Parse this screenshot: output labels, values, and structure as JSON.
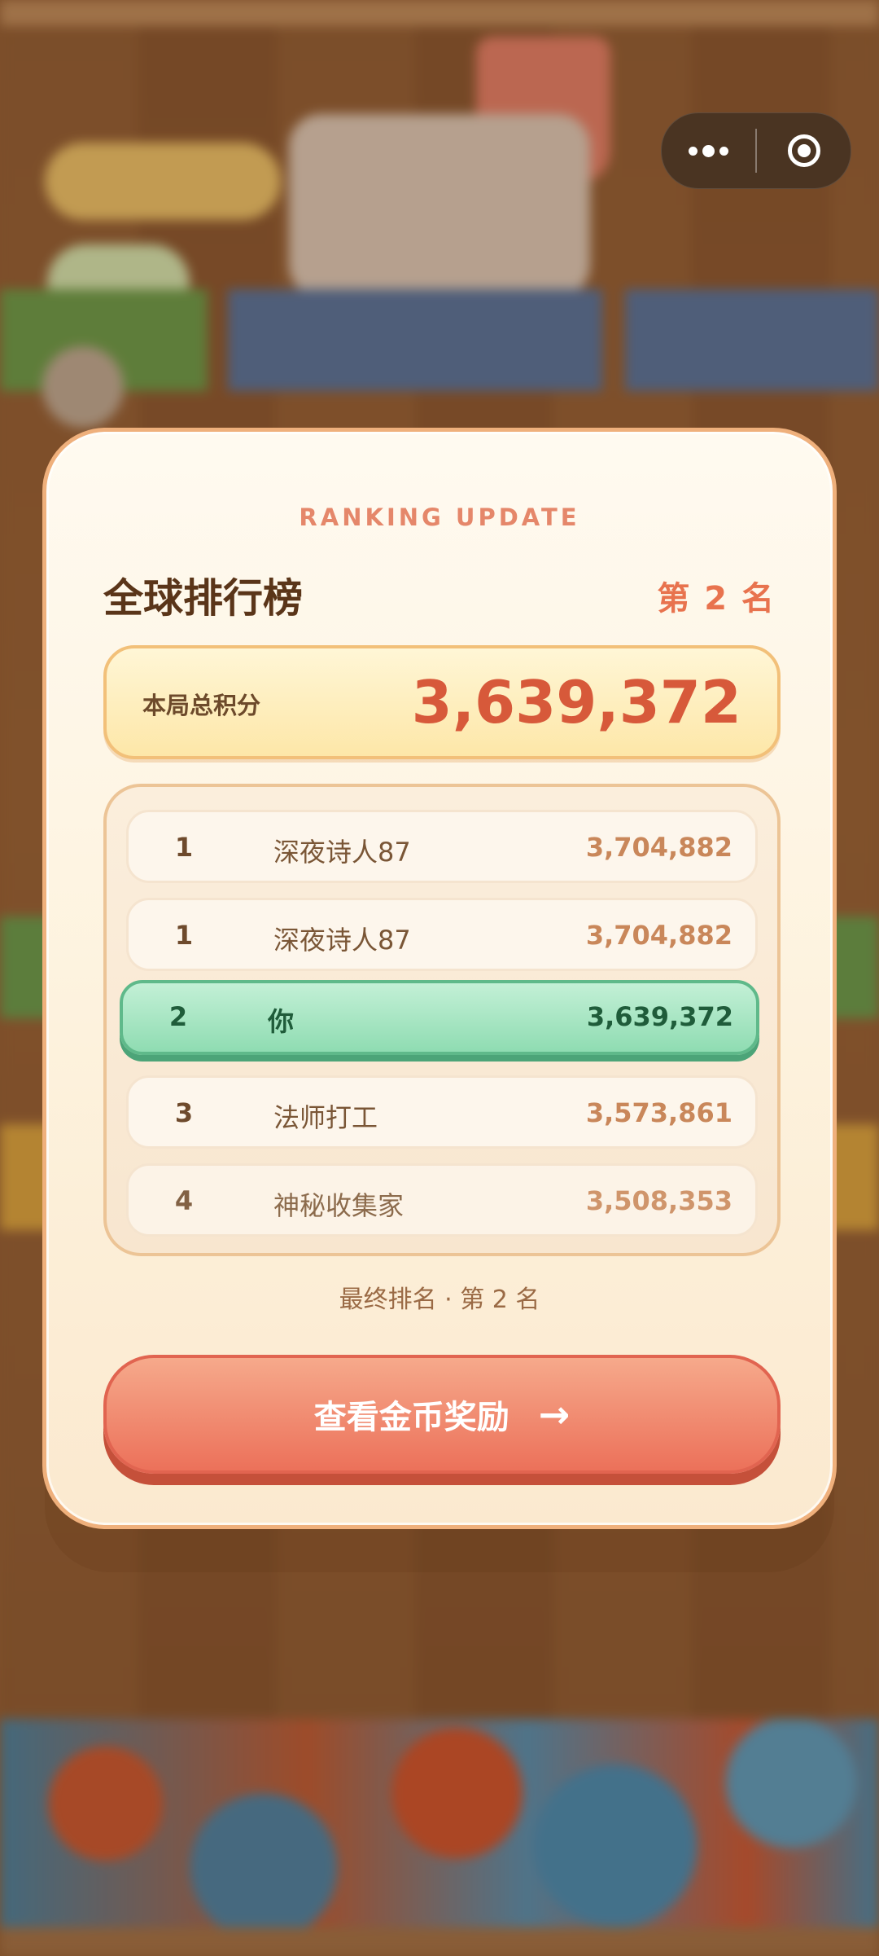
{
  "modal": {
    "eyebrow": "RANKING UPDATE",
    "title": "全球排行榜",
    "rank_badge": "第 2 名",
    "score_label": "本局总积分",
    "score_value": "3,639,372",
    "rows": [
      {
        "rank": "1",
        "name": "深夜诗人87",
        "score": "3,704,882"
      },
      {
        "rank": "1",
        "name": "深夜诗人87",
        "score": "3,704,882"
      },
      {
        "rank": "2",
        "name": "你",
        "score": "3,639,372"
      },
      {
        "rank": "3",
        "name": "法师打工",
        "score": "3,573,861"
      },
      {
        "rank": "4",
        "name": "神秘收集家",
        "score": "3,508,353"
      }
    ],
    "final_line": "最终排名 · 第 2 名",
    "cta_label": "查看金币奖励",
    "cta_arrow": "→"
  },
  "capsule": {
    "more_icon": "more-dots-icon",
    "close_icon": "target-close-icon"
  },
  "colors": {
    "accent": "#e8734e",
    "highlight_row": "#8fdcb2",
    "cta": "#ec715a",
    "score": "#d7593a"
  }
}
